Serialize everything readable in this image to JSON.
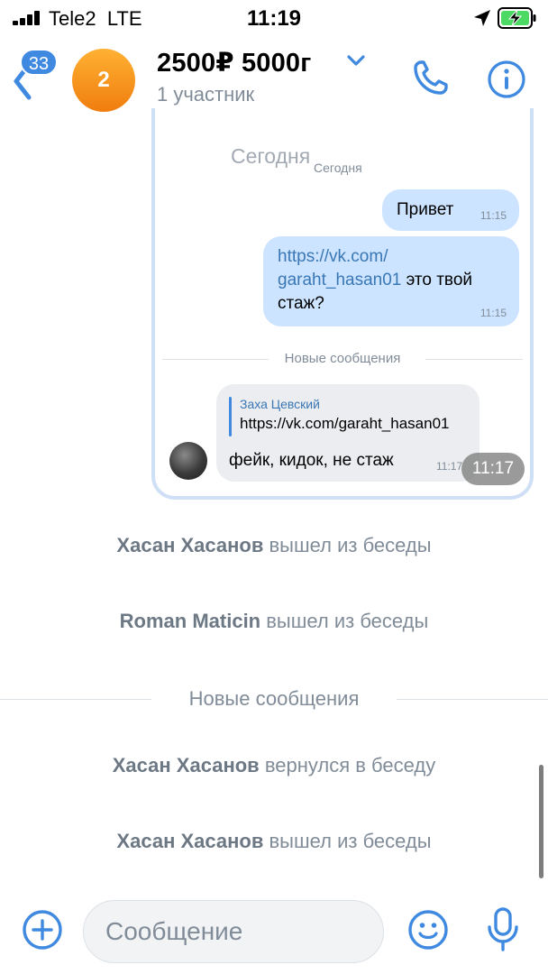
{
  "status_bar": {
    "carrier": "Tele2",
    "network": "LTE",
    "time": "11:19"
  },
  "header": {
    "unread_count": "33",
    "avatar_text": "2",
    "title": "2500₽ 5000г",
    "subtitle": "1 участник"
  },
  "forwarded_screenshot": {
    "ghost_date": "Сегодня",
    "date_label": "Сегодня",
    "messages": [
      {
        "text": "Привет",
        "time": "11:15"
      },
      {
        "link": "https://vk.com/garaht_hasan01",
        "link_line1": "https://vk.com/",
        "link_line2": "garaht_hasan01",
        "text": " это твой стаж?",
        "time": "11:15"
      }
    ],
    "new_messages_label": "Новые сообщения",
    "reply": {
      "sender": "Заха Цевский",
      "quoted": "https://vk.com/garaht_hasan01",
      "text": "фейк, кидок, не стаж",
      "time": "11:17"
    },
    "time_pill": "11:17"
  },
  "service_messages": [
    {
      "name": "Хасан Хасанов",
      "action": " вышел из беседы"
    },
    {
      "name": "Roman Maticin",
      "action": " вышел из беседы"
    },
    {
      "name": "Хасан Хасанов",
      "action": " вернулся в беседу"
    },
    {
      "name": "Хасан Хасанов",
      "action": " вышел из беседы"
    }
  ],
  "new_messages_separator": "Новые сообщения",
  "composer": {
    "placeholder": "Сообщение"
  },
  "colors": {
    "accent": "#3f8ae0",
    "outgoing_bubble": "#cce4ff",
    "incoming_bubble": "#ebedf0",
    "secondary_text": "#818c99",
    "avatar_orange": "#f5961e",
    "battery_green": "#4cd964"
  },
  "icons": [
    "signal-icon",
    "location-arrow-icon",
    "battery-charging-icon",
    "back-arrow-icon",
    "chevron-down-icon",
    "phone-icon",
    "info-icon",
    "plus-circle-icon",
    "emoji-icon",
    "microphone-icon"
  ]
}
